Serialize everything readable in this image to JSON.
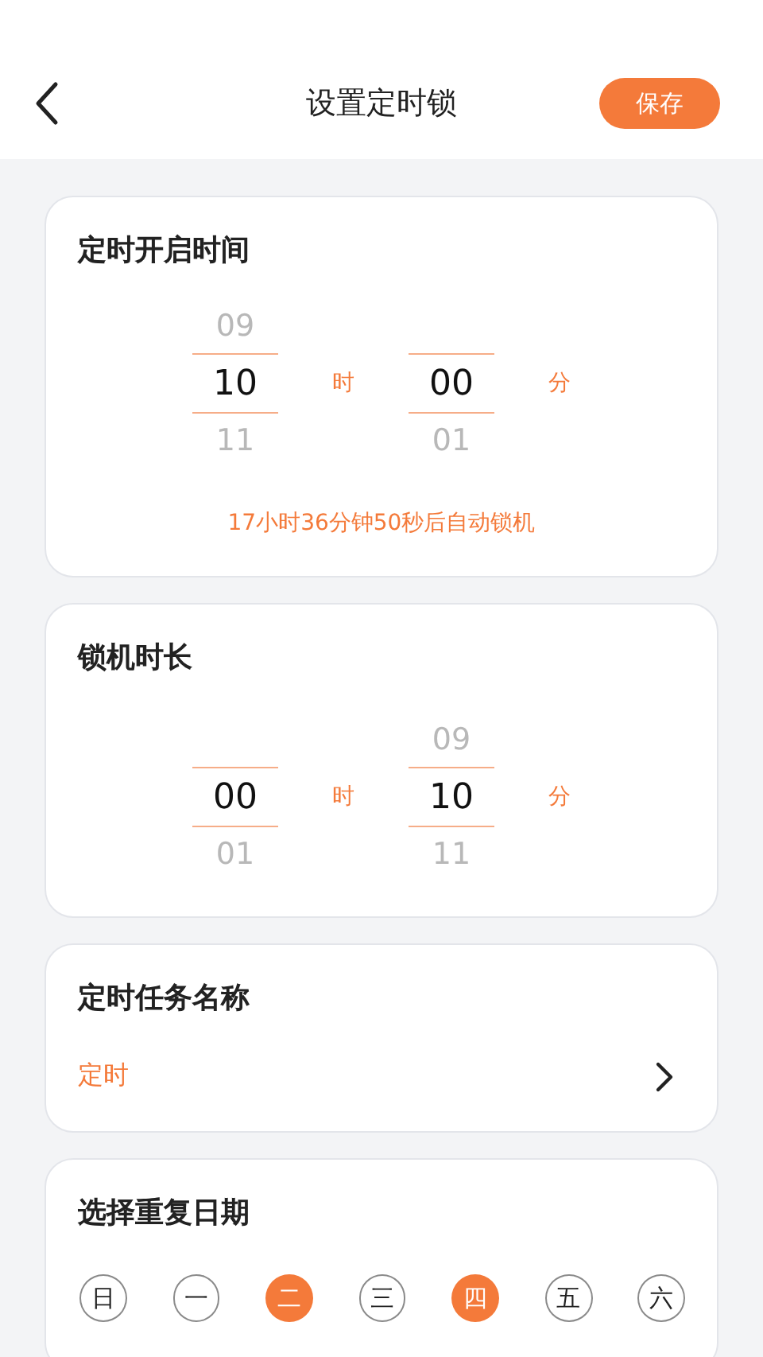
{
  "header": {
    "title": "设置定时锁",
    "save_button": "保存"
  },
  "start_card": {
    "title": "定时开启时间",
    "wheels": [
      {
        "prev": "09",
        "value": "10",
        "next": "11",
        "unit": "时"
      },
      {
        "value": "00",
        "next": "01",
        "unit": "分"
      }
    ],
    "countdown": "17小时36分钟50秒后自动锁机"
  },
  "duration_card": {
    "title": "锁机时长",
    "wheels": [
      {
        "value": "00",
        "next": "01",
        "unit": "时"
      },
      {
        "prev": "09",
        "value": "10",
        "next": "11",
        "unit": "分"
      }
    ]
  },
  "task_name_card": {
    "title": "定时任务名称",
    "value": "定时"
  },
  "repeat_card": {
    "title": "选择重复日期",
    "days": [
      {
        "label": "日",
        "selected": false
      },
      {
        "label": "一",
        "selected": false
      },
      {
        "label": "二",
        "selected": true
      },
      {
        "label": "三",
        "selected": false
      },
      {
        "label": "四",
        "selected": true
      },
      {
        "label": "五",
        "selected": false
      },
      {
        "label": "六",
        "selected": false
      }
    ]
  }
}
